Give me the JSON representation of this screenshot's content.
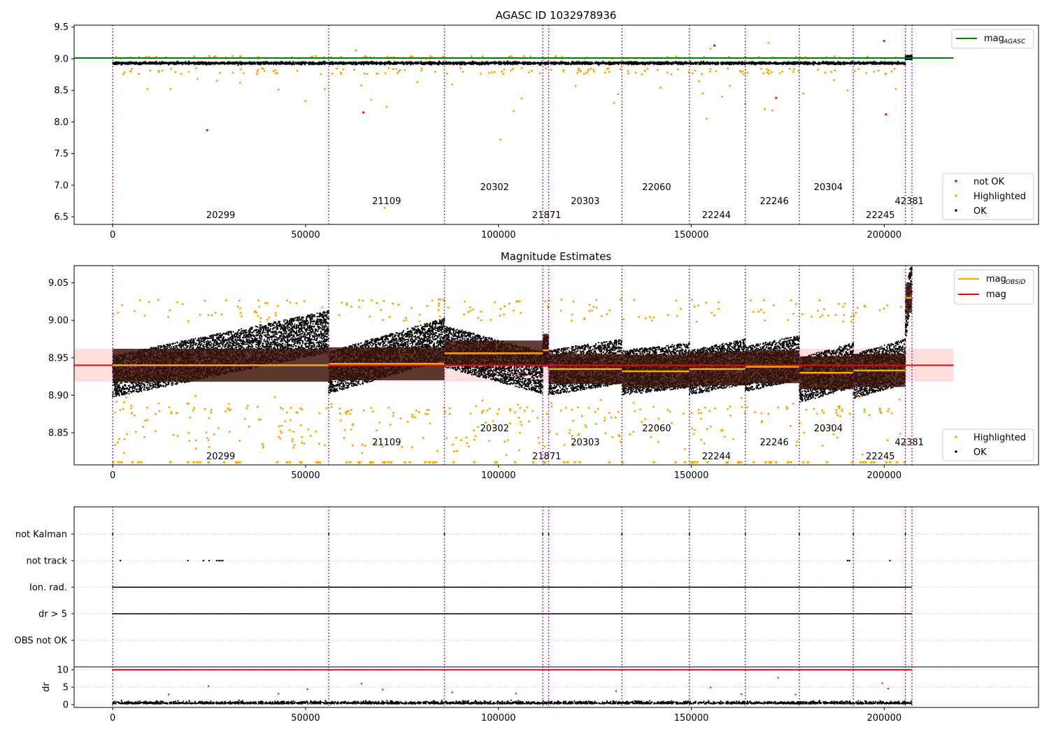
{
  "chart_data": [
    {
      "type": "scatter",
      "title": "AGASC ID 1032978936",
      "xlim": [
        -10000,
        240000
      ],
      "ylim": [
        6.38,
        9.53
      ],
      "x_ticks": [
        0,
        50000,
        100000,
        150000,
        200000
      ],
      "x_tick_labels": [
        "0",
        "50000",
        "100000",
        "150000",
        "200000"
      ],
      "y_ticks": [
        6.5,
        7.0,
        7.5,
        8.0,
        8.5,
        9.0,
        9.5
      ],
      "y_tick_labels": [
        "6.5",
        "7.0",
        "7.5",
        "8.0",
        "8.5",
        "9.0",
        "9.5"
      ],
      "mag_agasc": 9.01,
      "mag_agasc_line_x": [
        -10000,
        218000
      ],
      "legend_top": {
        "label_main": "mag",
        "label_sub": "AGASC",
        "color": "#008000",
        "position": "top-right"
      },
      "legend_bottom": [
        {
          "label": "not OK",
          "color": "#ff0000"
        },
        {
          "label": "Highlighted",
          "color": "#ffa500"
        },
        {
          "label": "OK",
          "color": "#000000"
        }
      ],
      "band": {
        "center": 8.93,
        "spread": 0.03
      },
      "red_points": [
        {
          "x": 24500,
          "y": 7.87
        },
        {
          "x": 65000,
          "y": 8.15
        },
        {
          "x": 156000,
          "y": 9.21
        },
        {
          "x": 172000,
          "y": 8.38
        },
        {
          "x": 200000,
          "y": 9.28
        },
        {
          "x": 200500,
          "y": 8.12
        }
      ],
      "orange_points": [
        {
          "x": 25000,
          "y": 9.04
        },
        {
          "x": 63000,
          "y": 9.13
        },
        {
          "x": 70500,
          "y": 6.64
        },
        {
          "x": 71000,
          "y": 8.24
        },
        {
          "x": 100500,
          "y": 7.72
        },
        {
          "x": 104000,
          "y": 8.17
        },
        {
          "x": 9000,
          "y": 8.52
        },
        {
          "x": 15000,
          "y": 8.52
        },
        {
          "x": 22000,
          "y": 8.68
        },
        {
          "x": 27000,
          "y": 8.65
        },
        {
          "x": 33000,
          "y": 8.62
        },
        {
          "x": 43000,
          "y": 8.51
        },
        {
          "x": 50000,
          "y": 8.33
        },
        {
          "x": 55000,
          "y": 8.52
        },
        {
          "x": 64500,
          "y": 8.58
        },
        {
          "x": 67000,
          "y": 8.35
        },
        {
          "x": 79000,
          "y": 8.63
        },
        {
          "x": 88000,
          "y": 8.59
        },
        {
          "x": 106000,
          "y": 8.37
        },
        {
          "x": 120000,
          "y": 8.57
        },
        {
          "x": 130000,
          "y": 8.3
        },
        {
          "x": 131000,
          "y": 8.44
        },
        {
          "x": 142000,
          "y": 8.54
        },
        {
          "x": 152000,
          "y": 8.64
        },
        {
          "x": 153000,
          "y": 8.45
        },
        {
          "x": 154000,
          "y": 8.05
        },
        {
          "x": 155000,
          "y": 9.16
        },
        {
          "x": 158000,
          "y": 8.4
        },
        {
          "x": 160000,
          "y": 8.57
        },
        {
          "x": 164000,
          "y": 8.29
        },
        {
          "x": 169000,
          "y": 8.2
        },
        {
          "x": 170000,
          "y": 9.25
        },
        {
          "x": 171000,
          "y": 8.18
        },
        {
          "x": 179000,
          "y": 8.45
        },
        {
          "x": 187000,
          "y": 8.66
        },
        {
          "x": 190500,
          "y": 8.5
        },
        {
          "x": 203000,
          "y": 8.52
        }
      ],
      "obsids": [
        {
          "label": "20299",
          "x_label": 28000,
          "level": 0
        },
        {
          "label": "21109",
          "x_label": 71000,
          "level": 1
        },
        {
          "label": "20302",
          "x_label": 99000,
          "level": 2
        },
        {
          "label": "21871",
          "x_label": 112500,
          "level": 0
        },
        {
          "label": "20303",
          "x_label": 122500,
          "level": 1
        },
        {
          "label": "22060",
          "x_label": 141000,
          "level": 2
        },
        {
          "label": "22244",
          "x_label": 156500,
          "level": 0
        },
        {
          "label": "22246",
          "x_label": 171500,
          "level": 1
        },
        {
          "label": "20304",
          "x_label": 185500,
          "level": 2
        },
        {
          "label": "22245",
          "x_label": 199000,
          "level": 0
        },
        {
          "label": "42381",
          "x_label": 206500,
          "level": 1
        }
      ]
    },
    {
      "type": "scatter",
      "title": "Magnitude Estimates",
      "xlim": [
        -10000,
        240000
      ],
      "ylim": [
        8.807,
        9.073
      ],
      "x_ticks": [
        0,
        50000,
        100000,
        150000,
        200000
      ],
      "x_tick_labels": [
        "0",
        "50000",
        "100000",
        "150000",
        "200000"
      ],
      "y_ticks": [
        8.85,
        8.9,
        8.95,
        9.0,
        9.05
      ],
      "y_tick_labels": [
        "8.85",
        "8.90",
        "8.95",
        "9.00",
        "9.05"
      ],
      "mag_mean": 8.94,
      "mag_std": 0.022,
      "legend_top": [
        {
          "label_main": "mag",
          "label_sub": "OBSID",
          "color": "#ffa500"
        },
        {
          "label_main": "mag",
          "label_sub": "",
          "color": "#ff0000"
        }
      ],
      "legend_bottom": [
        {
          "label": "Highlighted",
          "color": "#ffa500"
        },
        {
          "label": "OK",
          "color": "#000000"
        }
      ],
      "obsid_segments": [
        {
          "x0": 0,
          "x1": 56000,
          "mean": 8.94,
          "std": 0.022,
          "noise": 0.028,
          "trend": [
            8.925,
            8.985
          ]
        },
        {
          "x0": 56000,
          "x1": 86000,
          "mean": 8.942,
          "std": 0.022,
          "noise": 0.028,
          "trend": [
            8.93,
            8.975
          ]
        },
        {
          "x0": 86000,
          "x1": 111500,
          "mean": 8.956,
          "std": 0.017,
          "noise": 0.028,
          "trend": [
            8.965,
            8.93
          ]
        },
        {
          "x0": 111500,
          "x1": 113000,
          "mean": 8.96,
          "std": 0.022,
          "noise": 0.02,
          "trend": [
            8.96,
            8.96
          ]
        },
        {
          "x0": 113000,
          "x1": 132000,
          "mean": 8.935,
          "std": 0.02,
          "noise": 0.03,
          "trend": [
            8.93,
            8.945
          ]
        },
        {
          "x0": 132000,
          "x1": 149500,
          "mean": 8.932,
          "std": 0.022,
          "noise": 0.03,
          "trend": [
            8.93,
            8.94
          ]
        },
        {
          "x0": 149500,
          "x1": 164000,
          "mean": 8.935,
          "std": 0.022,
          "noise": 0.03,
          "trend": [
            8.93,
            8.945
          ]
        },
        {
          "x0": 164000,
          "x1": 178000,
          "mean": 8.938,
          "std": 0.022,
          "noise": 0.03,
          "trend": [
            8.935,
            8.95
          ]
        },
        {
          "x0": 178000,
          "x1": 192000,
          "mean": 8.93,
          "std": 0.022,
          "noise": 0.03,
          "trend": [
            8.92,
            8.94
          ]
        },
        {
          "x0": 192000,
          "x1": 205500,
          "mean": 8.933,
          "std": 0.022,
          "noise": 0.03,
          "trend": [
            8.925,
            8.945
          ]
        },
        {
          "x0": 205500,
          "x1": 207200,
          "mean": 9.03,
          "std": 0.02,
          "noise": 0.03,
          "trend": [
            9.0,
            9.06
          ]
        }
      ],
      "obsids": [
        {
          "label": "20299",
          "x_label": 28000,
          "level": 0
        },
        {
          "label": "21109",
          "x_label": 71000,
          "level": 1
        },
        {
          "label": "20302",
          "x_label": 99000,
          "level": 2
        },
        {
          "label": "21871",
          "x_label": 112500,
          "level": 0
        },
        {
          "label": "20303",
          "x_label": 122500,
          "level": 1
        },
        {
          "label": "22060",
          "x_label": 141000,
          "level": 2
        },
        {
          "label": "22244",
          "x_label": 156500,
          "level": 0
        },
        {
          "label": "22246",
          "x_label": 171500,
          "level": 1
        },
        {
          "label": "20304",
          "x_label": 185500,
          "level": 2
        },
        {
          "label": "22245",
          "x_label": 199000,
          "level": 0
        },
        {
          "label": "42381",
          "x_label": 206500,
          "level": 1
        }
      ]
    },
    {
      "type": "scatter",
      "xlim": [
        -10000,
        240000
      ],
      "flag_labels": [
        "not Kalman",
        "not track",
        "Ion. rad.",
        "dr > 5",
        "OBS not OK"
      ],
      "not_kalman_x": [
        0,
        56000,
        86000,
        111500,
        113000,
        132000,
        149500,
        164000,
        178000,
        192000,
        205500
      ],
      "not_track_x": [
        2000,
        19500,
        23500,
        25000,
        27000,
        27500,
        28000,
        28500,
        190500,
        191000,
        201500
      ],
      "ion_rad_range": [
        0,
        207200
      ],
      "dr_gt5_range": [
        0,
        207200
      ],
      "obs_not_ok_x": []
    },
    {
      "type": "scatter",
      "ylabel": "dr",
      "xlim": [
        -10000,
        240000
      ],
      "ylim": [
        -0.8,
        10.8
      ],
      "x_ticks": [
        0,
        50000,
        100000,
        150000,
        200000
      ],
      "x_tick_labels": [
        "0",
        "50000",
        "100000",
        "150000",
        "200000"
      ],
      "y_ticks": [
        0,
        5,
        10
      ],
      "y_tick_labels": [
        "0",
        "5",
        "10"
      ],
      "dr_clip_value": 10,
      "dr_outliers": [
        {
          "x": 14500,
          "y": 2.9
        },
        {
          "x": 24800,
          "y": 5.3
        },
        {
          "x": 43000,
          "y": 3.1
        },
        {
          "x": 50500,
          "y": 4.4
        },
        {
          "x": 64500,
          "y": 6.0
        },
        {
          "x": 70000,
          "y": 4.3
        },
        {
          "x": 88000,
          "y": 3.5
        },
        {
          "x": 104500,
          "y": 3.2
        },
        {
          "x": 130500,
          "y": 3.9
        },
        {
          "x": 155000,
          "y": 4.9
        },
        {
          "x": 163000,
          "y": 3.0
        },
        {
          "x": 172500,
          "y": 7.7
        },
        {
          "x": 177000,
          "y": 2.9
        },
        {
          "x": 199500,
          "y": 6.1
        },
        {
          "x": 201000,
          "y": 4.6
        }
      ]
    }
  ]
}
